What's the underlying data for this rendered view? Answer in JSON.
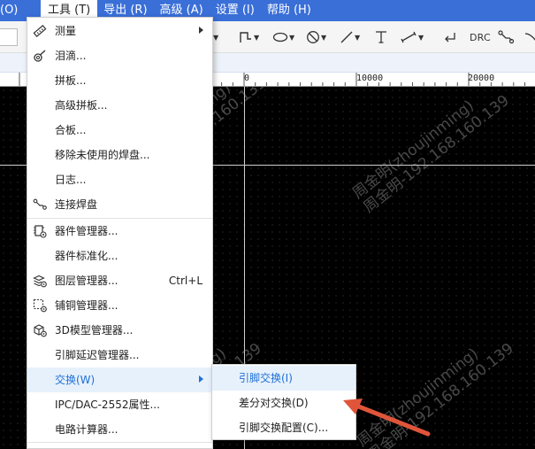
{
  "menubar": {
    "items": [
      {
        "label": "(O)"
      },
      {
        "label": "工具 (T)"
      },
      {
        "label": "导出 (R)"
      },
      {
        "label": "高级 (A)"
      },
      {
        "label": "设置 (I)"
      },
      {
        "label": "帮助 (H)"
      }
    ]
  },
  "toolbar": {
    "drc_label": "DRC"
  },
  "ruler": {
    "labels": [
      "0",
      "10000",
      "20000"
    ]
  },
  "tools_menu": {
    "items": [
      {
        "label": "测量",
        "icon": "ruler-icon",
        "submenu": true
      },
      {
        "label": "泪滴...",
        "icon": "teardrop-icon"
      },
      {
        "label": "拼板...",
        "icon": ""
      },
      {
        "label": "高级拼板...",
        "icon": ""
      },
      {
        "label": "合板...",
        "icon": ""
      },
      {
        "label": "移除未使用的焊盘...",
        "icon": ""
      },
      {
        "label": "日志...",
        "icon": ""
      },
      {
        "label": "连接焊盘",
        "icon": "connect-pads-icon"
      },
      {
        "label": "器件管理器...",
        "icon": "component-manager-icon"
      },
      {
        "label": "器件标准化...",
        "icon": ""
      },
      {
        "label": "图层管理器...",
        "icon": "layer-manager-icon",
        "shortcut": "Ctrl+L"
      },
      {
        "label": "铺铜管理器...",
        "icon": "copper-pour-manager-icon"
      },
      {
        "label": "3D模型管理器...",
        "icon": "3d-model-icon"
      },
      {
        "label": "引脚延迟管理器...",
        "icon": ""
      },
      {
        "label": "交换(W)",
        "icon": "",
        "submenu": true,
        "selected": true
      },
      {
        "label": "IPC/DAC-2552属性...",
        "icon": ""
      },
      {
        "label": "电路计算器...",
        "icon": ""
      }
    ]
  },
  "swap_submenu": {
    "items": [
      {
        "label": "引脚交换(I)",
        "selected": true
      },
      {
        "label": "差分对交换(D)"
      },
      {
        "label": "引脚交换配置(C)..."
      }
    ]
  },
  "watermark": {
    "line1": "周金明(zhoujinming)",
    "line2": "周金明-192.168.160.139"
  },
  "colors": {
    "menubar": "#3a6fd8",
    "selection_text": "#1f6fd6",
    "selection_bg": "#e6f1fc",
    "annotation_arrow": "#e0553a"
  }
}
